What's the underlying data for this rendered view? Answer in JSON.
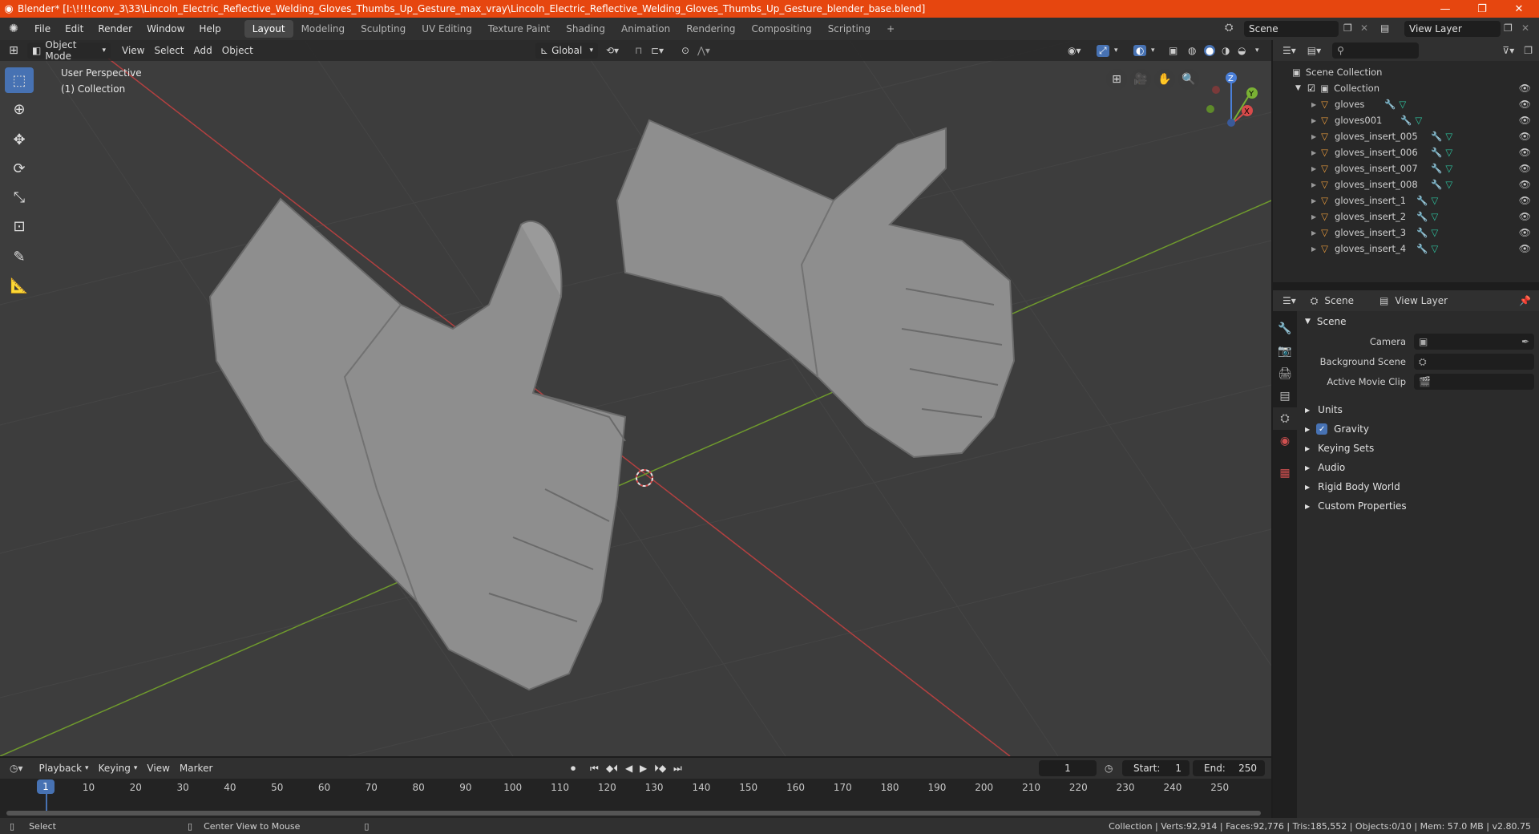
{
  "window": {
    "title": "Blender* [I:\\!!!!conv_3\\33\\Lincoln_Electric_Reflective_Welding_Gloves_Thumbs_Up_Gesture_max_vray\\Lincoln_Electric_Reflective_Welding_Gloves_Thumbs_Up_Gesture_blender_base.blend]",
    "minimize": "—",
    "restore": "❐",
    "close": "✕",
    "title_bar_color": "#e6460f"
  },
  "menu": {
    "items": [
      "File",
      "Edit",
      "Render",
      "Window",
      "Help"
    ],
    "workspaces": [
      "Layout",
      "Modeling",
      "Sculpting",
      "UV Editing",
      "Texture Paint",
      "Shading",
      "Animation",
      "Rendering",
      "Compositing",
      "Scripting"
    ],
    "active_workspace": "Layout",
    "add_workspace": "+",
    "scene_name": "Scene",
    "view_layer": "View Layer"
  },
  "viewport": {
    "mode": "Object Mode",
    "menus": [
      "View",
      "Select",
      "Add",
      "Object"
    ],
    "orientation": "Global",
    "perspective_label": "User Perspective",
    "collection_label": "(1) Collection",
    "gizmo": {
      "x": "X",
      "y": "Y",
      "z": "Z"
    },
    "background_color": "#3d3d3d",
    "accent_color": "#4772b3"
  },
  "outliner": {
    "scene_collection": "Scene Collection",
    "collection": "Collection",
    "objects": [
      "gloves",
      "gloves001",
      "gloves_insert_005",
      "gloves_insert_006",
      "gloves_insert_007",
      "gloves_insert_008",
      "gloves_insert_1",
      "gloves_insert_2",
      "gloves_insert_3",
      "gloves_insert_4"
    ]
  },
  "properties": {
    "header_scene": "Scene",
    "header_view_layer": "View Layer",
    "section": "Scene",
    "camera_label": "Camera",
    "background_scene_label": "Background Scene",
    "active_movie_clip_label": "Active Movie Clip",
    "subsections": [
      "Units",
      "Gravity",
      "Keying Sets",
      "Audio",
      "Rigid Body World",
      "Custom Properties"
    ]
  },
  "timeline": {
    "menus": [
      "Playback",
      "Keying",
      "View",
      "Marker"
    ],
    "current_frame": "1",
    "start_label": "Start:",
    "start": "1",
    "end_label": "End:",
    "end": "250",
    "ticks": [
      "1",
      "10",
      "20",
      "30",
      "40",
      "50",
      "60",
      "70",
      "80",
      "90",
      "100",
      "110",
      "120",
      "130",
      "140",
      "150",
      "160",
      "170",
      "180",
      "190",
      "200",
      "210",
      "220",
      "230",
      "240",
      "250"
    ]
  },
  "status": {
    "select": "Select",
    "center_view": "Center View to Mouse",
    "stats": "Collection | Verts:92,914 | Faces:92,776 | Tris:185,552 | Objects:0/10 | Mem: 57.0 MB | v2.80.75"
  }
}
